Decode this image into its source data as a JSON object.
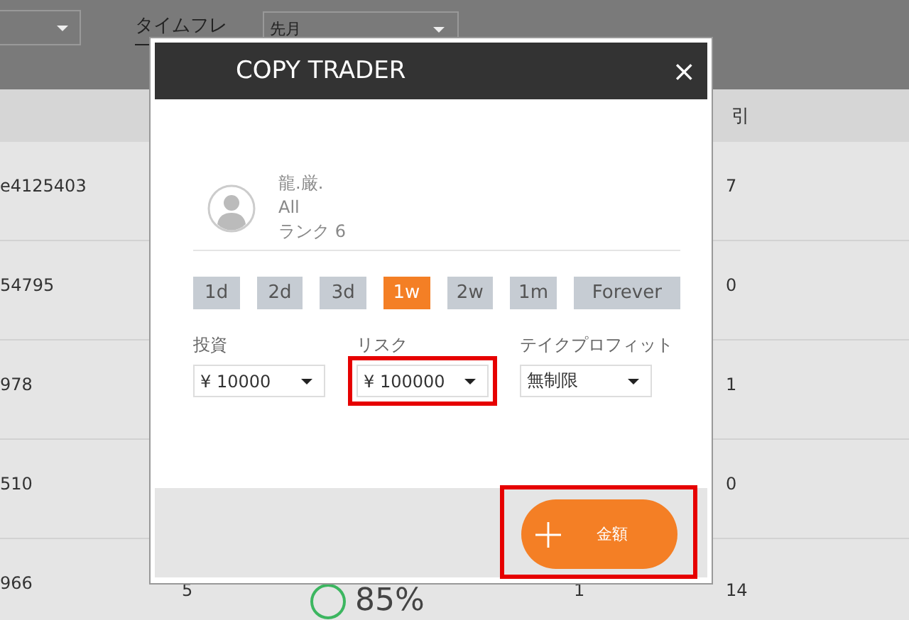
{
  "top_bar": {
    "timeframe": {
      "label": "タイムフレ",
      "value": "先月"
    }
  },
  "table": {
    "header": {
      "column_5": "引"
    },
    "rows": [
      {
        "column_1": "e4125403",
        "column_5": "7"
      },
      {
        "column_1": "54795",
        "column_5": "0"
      },
      {
        "column_1": "978",
        "column_5": "1"
      },
      {
        "column_1": "510",
        "column_5": "0"
      },
      {
        "column_1": "966",
        "column_2": "5",
        "rate": "85%",
        "column_4": "1",
        "column_5": "14"
      }
    ]
  },
  "modal": {
    "title": "COPY TRADER",
    "close": "×",
    "trader": {
      "name": "龍.厳.",
      "market": "All",
      "rank": "ランク 6"
    },
    "periods": [
      {
        "label": "1d",
        "selected": false
      },
      {
        "label": "2d",
        "selected": false
      },
      {
        "label": "3d",
        "selected": false
      },
      {
        "label": "1w",
        "selected": true
      },
      {
        "label": "2w",
        "selected": false
      },
      {
        "label": "1m",
        "selected": false
      },
      {
        "label": "Forever",
        "selected": false
      }
    ],
    "fields": [
      {
        "label": "投資",
        "value": "¥ 10000",
        "highlighted": false
      },
      {
        "label": "リスク",
        "value": "¥ 100000",
        "highlighted": true
      },
      {
        "label": "テイクプロフィット",
        "value": "無制限",
        "highlighted": false
      }
    ],
    "action": {
      "label": "金額",
      "highlighted": true
    }
  }
}
